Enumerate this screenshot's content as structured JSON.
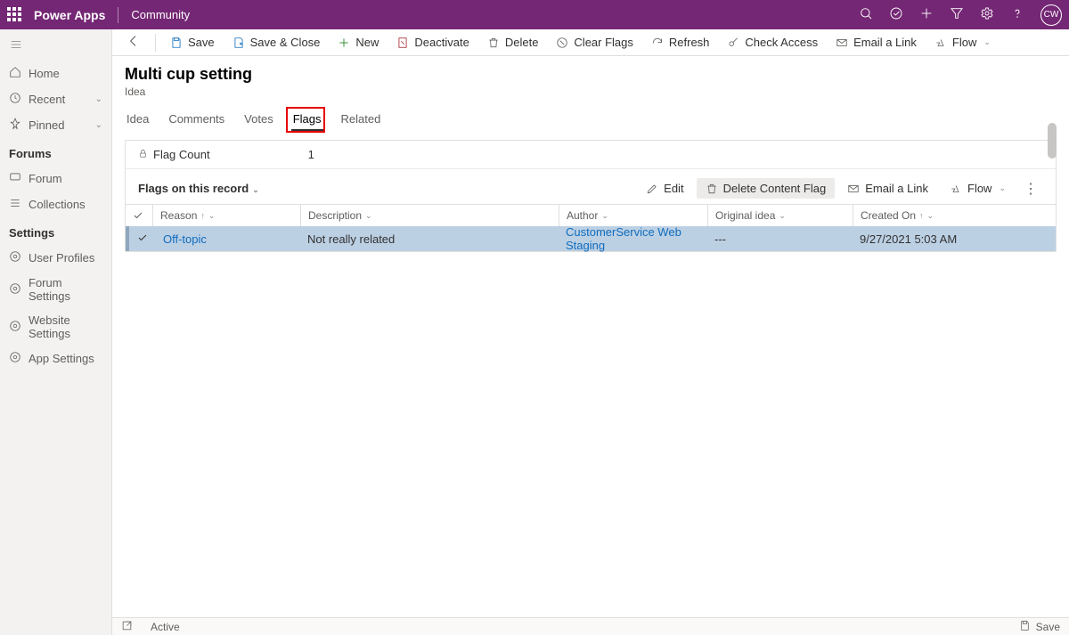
{
  "header": {
    "app_name": "Power Apps",
    "environment": "Community",
    "avatar_initials": "CW"
  },
  "leftnav": {
    "home": "Home",
    "recent": "Recent",
    "pinned": "Pinned",
    "section_forums": "Forums",
    "forum": "Forum",
    "collections": "Collections",
    "section_settings": "Settings",
    "user_profiles": "User Profiles",
    "forum_settings": "Forum Settings",
    "website_settings": "Website Settings",
    "app_settings": "App Settings"
  },
  "commandbar": {
    "save": "Save",
    "save_close": "Save & Close",
    "new": "New",
    "deactivate": "Deactivate",
    "delete": "Delete",
    "clear_flags": "Clear Flags",
    "refresh": "Refresh",
    "check_access": "Check Access",
    "email_link": "Email a Link",
    "flow": "Flow"
  },
  "page": {
    "title": "Multi cup setting",
    "subtitle": "Idea"
  },
  "tabs": {
    "idea": "Idea",
    "comments": "Comments",
    "votes": "Votes",
    "flags": "Flags",
    "related": "Related"
  },
  "flag_count": {
    "label": "Flag Count",
    "value": "1"
  },
  "subgrid": {
    "title": "Flags on this record",
    "actions": {
      "edit": "Edit",
      "delete_flag": "Delete Content Flag",
      "email_link": "Email a Link",
      "flow": "Flow"
    },
    "columns": {
      "reason": "Reason",
      "description": "Description",
      "author": "Author",
      "original_idea": "Original idea",
      "created_on": "Created On"
    },
    "rows": [
      {
        "reason": "Off-topic",
        "description": "Not really related",
        "author": "CustomerService Web Staging",
        "original_idea": "---",
        "created_on": "9/27/2021 5:03 AM"
      }
    ]
  },
  "statusbar": {
    "status": "Active",
    "save": "Save"
  }
}
